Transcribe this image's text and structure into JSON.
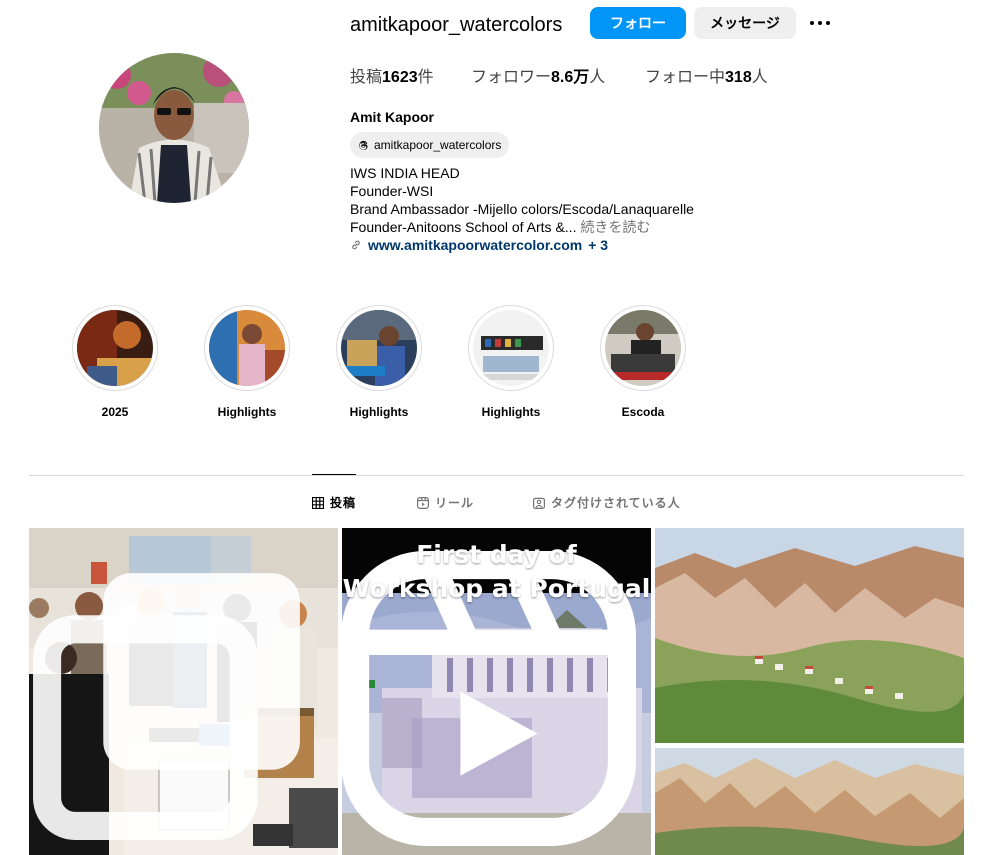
{
  "profile": {
    "username": "amitkapoor_watercolors",
    "follow_label": "フォロー",
    "message_label": "メッセージ",
    "full_name": "Amit Kapoor",
    "threads_handle": "amitkapoor_watercolors"
  },
  "stats": {
    "posts_label": "投稿",
    "posts_count": "1623",
    "posts_unit": "件",
    "followers_label": "フォロワー",
    "followers_count": "8.6万",
    "followers_unit": "人",
    "following_label": "フォロー中",
    "following_count": "318",
    "following_unit": "人"
  },
  "bio": {
    "lines": [
      "IWS INDIA HEAD",
      "Founder-WSI",
      "Brand Ambassador -Mijello colors/Escoda/Lanaquarelle",
      "Founder-Anitoons School of Arts &..."
    ],
    "more_label": "続きを読む",
    "link_text": "www.amitkapoorwatercolor.com",
    "link_extra": "+ 3"
  },
  "highlights": [
    {
      "label": "2025"
    },
    {
      "label": "Highlights"
    },
    {
      "label": "Highlights"
    },
    {
      "label": "Highlights"
    },
    {
      "label": "Escoda"
    }
  ],
  "tabs": [
    {
      "label": "投稿",
      "icon": "grid-icon",
      "active": true
    },
    {
      "label": "リール",
      "icon": "reels-icon",
      "active": false
    },
    {
      "label": "タグ付けされている人",
      "icon": "tagged-icon",
      "active": false
    }
  ],
  "posts": [
    {
      "kind": "photo",
      "icon": "multiple-posts-icon"
    },
    {
      "kind": "reel",
      "title": "First day of Workshop at Portugal",
      "icon": "reel-icon"
    },
    {
      "kind": "photo",
      "icon": ""
    }
  ],
  "colors": {
    "accent_blue": "#0095f6",
    "link_blue": "#00376b",
    "secondary_btn": "#efefef",
    "divider": "#dbdbdb"
  }
}
